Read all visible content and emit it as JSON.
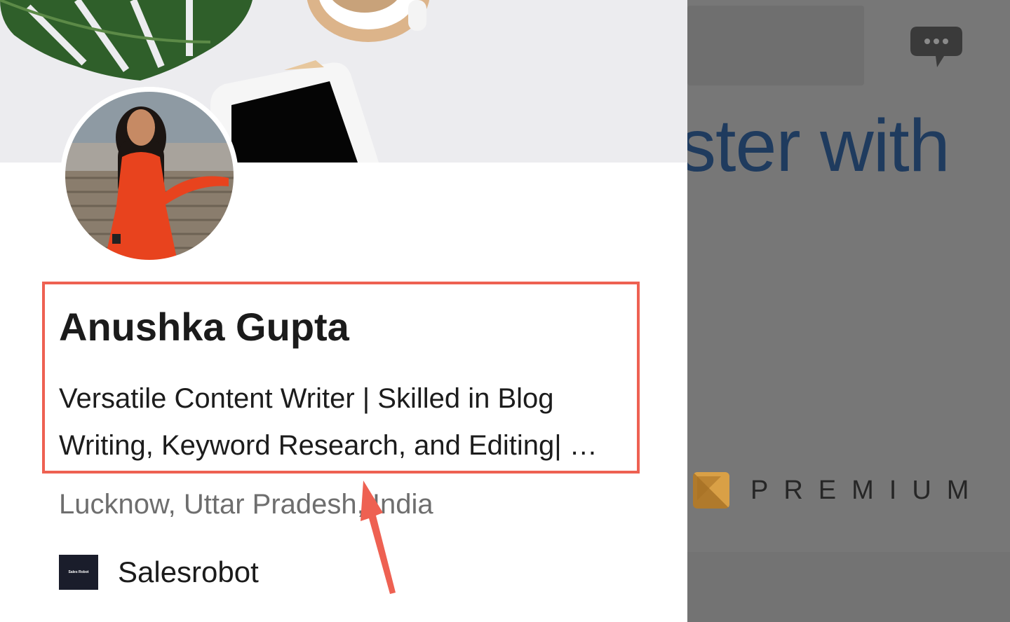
{
  "profile": {
    "name": "Anushka Gupta",
    "headline_line1": "Versatile Content Writer | Skilled in Blog",
    "headline_line2": "Writing, Keyword Research, and Editing| …",
    "location": "Lucknow, Uttar Pradesh, India",
    "company": {
      "name": "Salesrobot",
      "logo_text": "Sales Robot"
    }
  },
  "background_page": {
    "headline_fragment": "ster with",
    "premium_label": "PREMIUM"
  },
  "annotation": {
    "highlight_color": "#ee6152",
    "arrow_color": "#ee6152"
  },
  "colors": {
    "overlay": "#777777",
    "headline_blue": "#1f3b5e",
    "premium_gold": "#d9a046"
  },
  "icons": {
    "chat": "chat-bubble-icon",
    "premium": "premium-logo-icon",
    "company": "company-logo-icon"
  }
}
